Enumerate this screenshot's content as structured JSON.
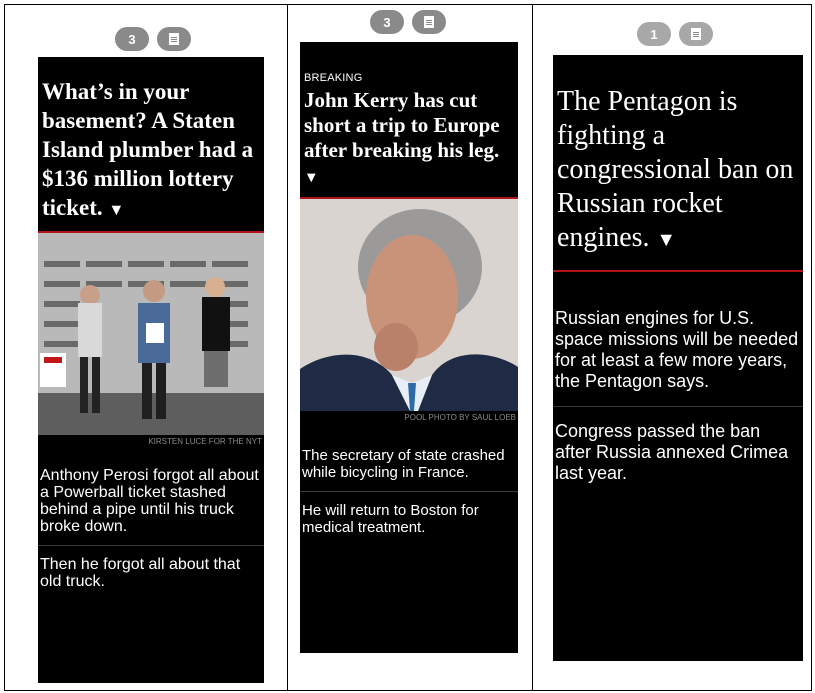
{
  "caption": "Figure",
  "columns": [
    {
      "badge_count": "3",
      "kicker": "",
      "headline": "What’s in your basement? A Staten Island plumber had a $136 million lottery ticket.",
      "photo_credit": "KIRSTEN LUCE FOR THE NYT",
      "paragraphs": [
        "Anthony Perosi forgot all about a Powerball ticket stashed behind a pipe until his truck broke down.",
        "Then he forgot all about that old truck."
      ]
    },
    {
      "badge_count": "3",
      "kicker": "BREAKING",
      "headline": "John Kerry has cut short a trip to Europe after breaking his leg.",
      "photo_credit": "POOL PHOTO BY SAUL LOEB",
      "paragraphs": [
        "The secretary of state crashed while bicycling in France.",
        "He will return to Boston for medical treatment."
      ]
    },
    {
      "badge_count": "1",
      "kicker": "",
      "headline": "The Pentagon is fighting a congressional ban on Russian rocket engines.",
      "photo_credit": "",
      "paragraphs": [
        "Russian engines for U.S. space missions will be needed for at least a few more years, the Pentagon says.",
        "Congress passed the ban after Russia annexed Crimea last year."
      ]
    }
  ],
  "arrow_glyph": "▼",
  "icons": {
    "comments_badge": "comment-count-badge",
    "doc": "document-icon"
  }
}
